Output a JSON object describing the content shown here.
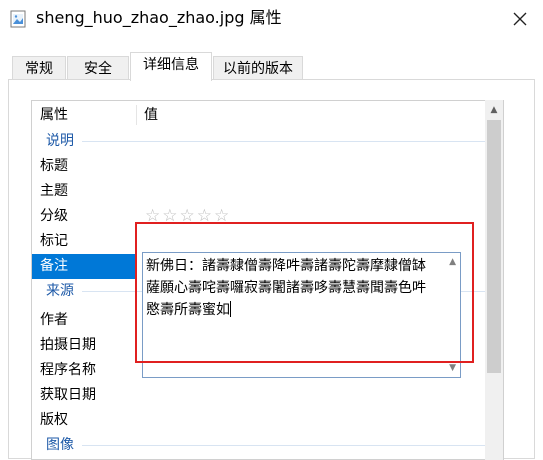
{
  "window": {
    "title": "sheng_huo_zhao_zhao.jpg 属性",
    "close_glyph": "✕"
  },
  "tabs": [
    {
      "label": "常规",
      "active": false
    },
    {
      "label": "安全",
      "active": false
    },
    {
      "label": "详细信息",
      "active": true
    },
    {
      "label": "以前的版本",
      "active": false
    }
  ],
  "columns": {
    "property": "属性",
    "value": "值"
  },
  "rows": [
    {
      "label": "说明",
      "type": "section"
    },
    {
      "label": "标题"
    },
    {
      "label": "主题"
    },
    {
      "label": "分级",
      "rating_stars": "☆☆☆☆☆"
    },
    {
      "label": "标记"
    },
    {
      "label": "备注",
      "selected": true
    },
    {
      "label": "来源",
      "type": "section"
    },
    {
      "label": "作者"
    },
    {
      "label": "拍摄日期"
    },
    {
      "label": "程序名称"
    },
    {
      "label": "获取日期"
    },
    {
      "label": "版权"
    },
    {
      "label": "图像",
      "type": "section"
    }
  ],
  "note": {
    "value": "新佛日：諸壽隸僧壽降吽壽諸壽陀壽摩隸僧缽薩願心壽咤壽囉寂壽闍諸壽哆壽慧壽聞壽色吽愍壽所壽蜜如"
  },
  "colors": {
    "accent": "#0078d7",
    "section_text": "#1e5aa8",
    "highlight_border": "#e02020"
  }
}
